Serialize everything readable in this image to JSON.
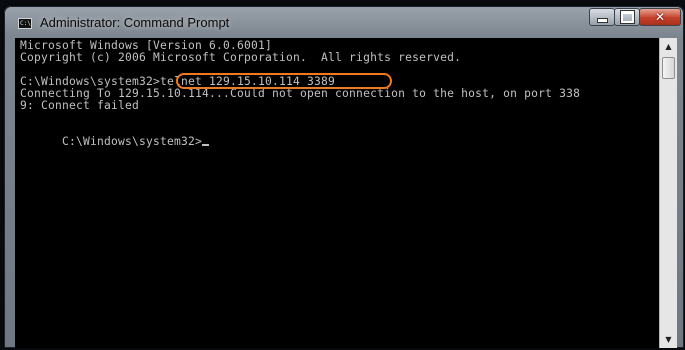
{
  "window": {
    "title": "Administrator: Command Prompt",
    "icon_text": "C:\\"
  },
  "controls": {
    "minimize_icon": "minimize-icon",
    "maximize_icon": "maximize-icon",
    "close_icon": "close-icon",
    "close_glyph": "✕"
  },
  "console": {
    "lines": [
      "Microsoft Windows [Version 6.0.6001]",
      "Copyright (c) 2006 Microsoft Corporation.  All rights reserved.",
      "",
      "C:\\Windows\\system32>telnet 129.15.10.114 3389",
      "Connecting To 129.15.10.114...Could not open connection to the host, on port 338",
      "9: Connect failed",
      "",
      "C:\\Windows\\system32>"
    ]
  },
  "scrollbar": {
    "up_arrow": "▲",
    "down_arrow": "▼"
  },
  "colors": {
    "highlight": "#f07a1e",
    "console_text": "#c0c0c0",
    "console_bg": "#000000"
  }
}
